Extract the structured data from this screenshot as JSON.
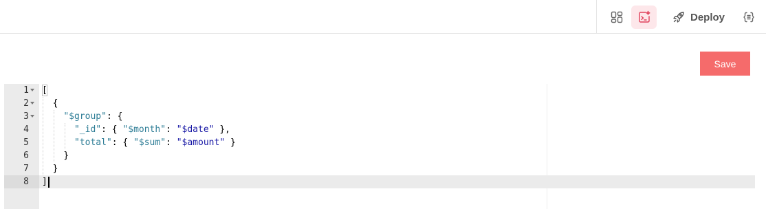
{
  "toolbar": {
    "layout_icon": "layout-grid-icon",
    "code_icon": "code-terminal-icon",
    "deploy_icon": "rocket-icon",
    "deploy_label": "Deploy",
    "api_icon": "api-braces-icon",
    "accent_color": "#f56b6b"
  },
  "actions": {
    "save_label": "Save"
  },
  "editor": {
    "line_numbers": [
      "1",
      "2",
      "3",
      "4",
      "5",
      "6",
      "7",
      "8"
    ],
    "lines": [
      {
        "indent": "",
        "parts": [
          {
            "t": "plain",
            "v": "["
          }
        ]
      },
      {
        "indent": "  ",
        "parts": [
          {
            "t": "plain",
            "v": "{"
          }
        ]
      },
      {
        "indent": "    ",
        "parts": [
          {
            "t": "str",
            "v": "\"$group\""
          },
          {
            "t": "plain",
            "v": ": {"
          }
        ]
      },
      {
        "indent": "      ",
        "parts": [
          {
            "t": "str",
            "v": "\"_id\""
          },
          {
            "t": "plain",
            "v": ": { "
          },
          {
            "t": "str",
            "v": "\"$month\""
          },
          {
            "t": "plain",
            "v": ": "
          },
          {
            "t": "strv",
            "v": "\"$date\""
          },
          {
            "t": "plain",
            "v": " },"
          }
        ]
      },
      {
        "indent": "      ",
        "parts": [
          {
            "t": "str",
            "v": "\"total\""
          },
          {
            "t": "plain",
            "v": ": { "
          },
          {
            "t": "str",
            "v": "\"$sum\""
          },
          {
            "t": "plain",
            "v": ": "
          },
          {
            "t": "strv",
            "v": "\"$amount\""
          },
          {
            "t": "plain",
            "v": " }"
          }
        ]
      },
      {
        "indent": "    ",
        "parts": [
          {
            "t": "plain",
            "v": "}"
          }
        ]
      },
      {
        "indent": "  ",
        "parts": [
          {
            "t": "plain",
            "v": "}"
          }
        ]
      },
      {
        "indent": "",
        "parts": [
          {
            "t": "plain",
            "v": "]"
          }
        ]
      }
    ],
    "active_line": 8
  }
}
